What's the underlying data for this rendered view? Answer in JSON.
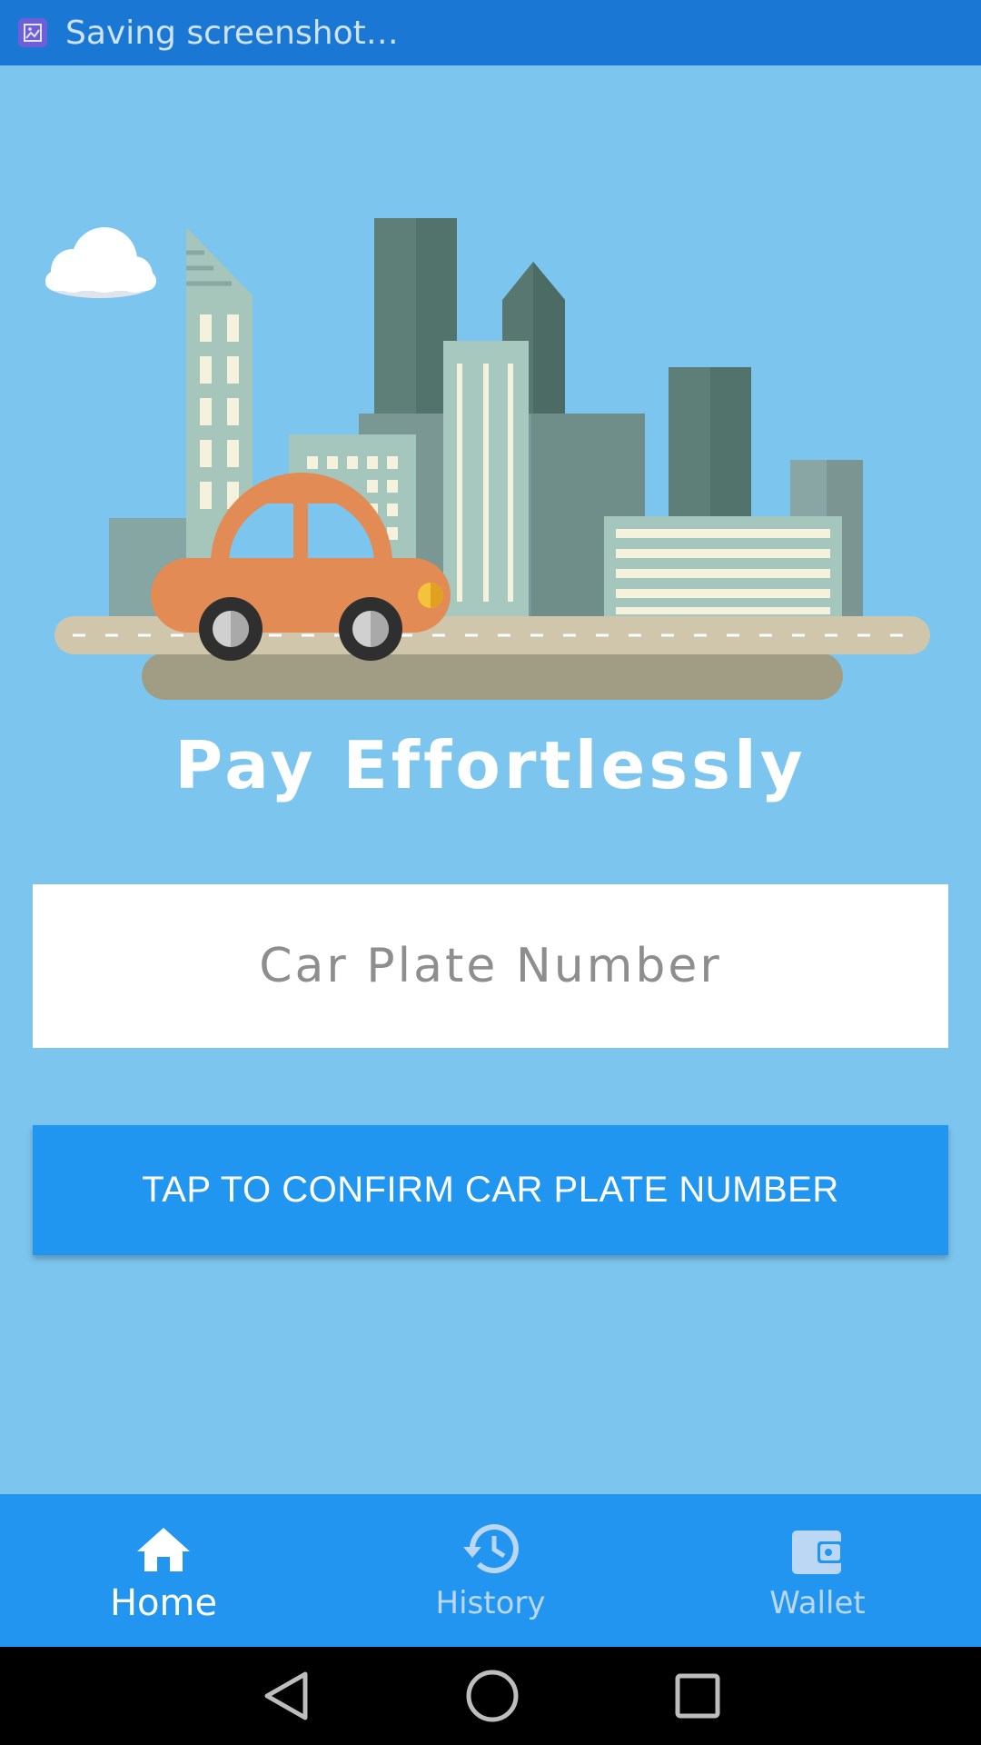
{
  "status_bar": {
    "notification_text": "Saving screenshot…",
    "icon": "screenshot-icon"
  },
  "main": {
    "headline": "Pay Effortlessly",
    "plate_input": {
      "placeholder": "Car Plate Number",
      "value": ""
    },
    "confirm_button_label": "TAP TO CONFIRM CAR PLATE NUMBER"
  },
  "bottom_nav": {
    "items": [
      {
        "label": "Home",
        "icon": "home-icon",
        "active": true
      },
      {
        "label": "History",
        "icon": "history-icon",
        "active": false
      },
      {
        "label": "Wallet",
        "icon": "wallet-icon",
        "active": false
      }
    ]
  },
  "system_nav": {
    "buttons": [
      "back-icon",
      "home-circle-icon",
      "recents-icon"
    ]
  },
  "colors": {
    "background": "#7cc5ee",
    "status_bar": "#1a78d4",
    "accent": "#2196f0",
    "car": "#e28b55"
  }
}
